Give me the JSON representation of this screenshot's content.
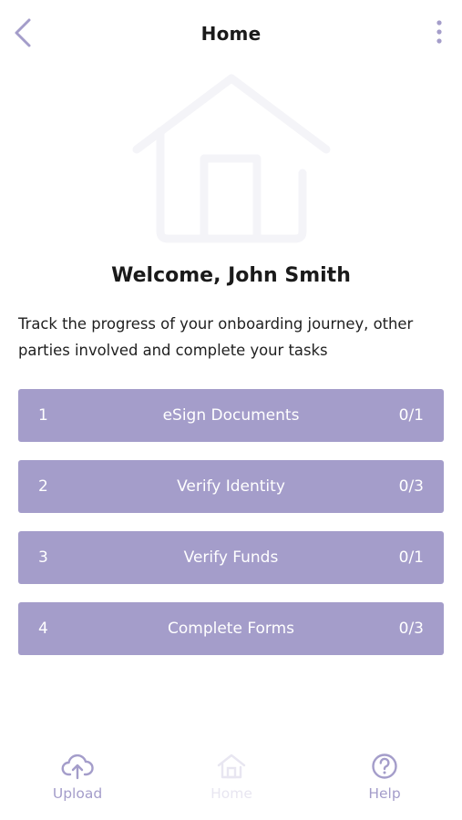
{
  "header": {
    "title": "Home",
    "back_icon": "chevron-left-icon",
    "menu_icon": "more-vertical-icon"
  },
  "hero": {
    "icon": "home-illustration"
  },
  "welcome": "Welcome, John Smith",
  "intro": "Track the progress of your onboarding journey, other parties involved and complete your tasks",
  "tasks": [
    {
      "number": "1",
      "label": "eSign Documents",
      "progress": "0/1"
    },
    {
      "number": "2",
      "label": "Verify Identity",
      "progress": "0/3"
    },
    {
      "number": "3",
      "label": "Verify Funds",
      "progress": "0/1"
    },
    {
      "number": "4",
      "label": "Complete Forms",
      "progress": "0/3"
    }
  ],
  "nav": {
    "upload": {
      "label": "Upload",
      "icon": "cloud-upload-icon"
    },
    "home": {
      "label": "Home",
      "icon": "home-icon",
      "active": true
    },
    "help": {
      "label": "Help",
      "icon": "help-circle-icon"
    }
  },
  "colors": {
    "accent": "#a49dca",
    "nav_active": "#a49dca",
    "nav_inactive": "#e8e6f1",
    "hero_outline": "#f4f4f8"
  }
}
